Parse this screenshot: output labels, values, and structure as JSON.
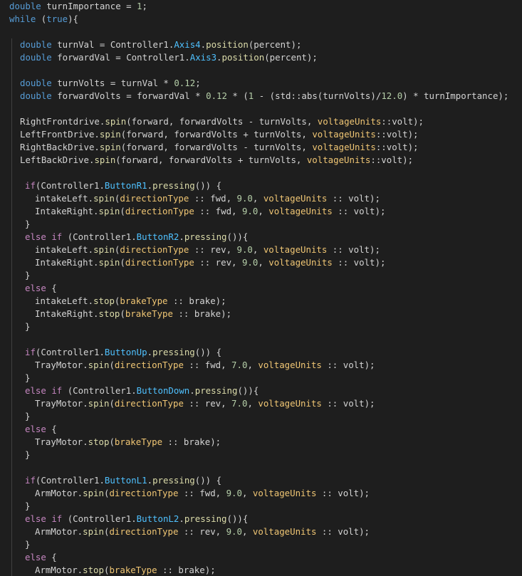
{
  "theme": {
    "background": "#1e1e1e",
    "default_text": "#d4d4d4",
    "colors": {
      "kw": "#569cd6",
      "id": "#d4d4d4",
      "fn": "#dcdcaa",
      "ty": "#4ec9b0",
      "num": "#b5cea8",
      "cf": "#c586c0",
      "mem": "#4fc1ff",
      "en": "#f0c674",
      "op": "#d4d4d4"
    }
  },
  "code_lines": [
    {
      "indent": 1,
      "tokens": [
        [
          "kw",
          "double"
        ],
        [
          "id",
          " turnImportance = "
        ],
        [
          "num",
          "1"
        ],
        [
          "id",
          ";"
        ]
      ]
    },
    {
      "indent": 1,
      "tokens": [
        [
          "kw",
          "while"
        ],
        [
          "id",
          " ("
        ],
        [
          "kw",
          "true"
        ],
        [
          "id",
          "){"
        ]
      ]
    },
    {
      "indent": 0,
      "tokens": []
    },
    {
      "indent": 3,
      "tokens": [
        [
          "kw",
          "double"
        ],
        [
          "id",
          " turnVal = Controller1."
        ],
        [
          "mem",
          "Axis4"
        ],
        [
          "id",
          "."
        ],
        [
          "fn",
          "position"
        ],
        [
          "id",
          "(percent);"
        ]
      ]
    },
    {
      "indent": 3,
      "tokens": [
        [
          "kw",
          "double"
        ],
        [
          "id",
          " forwardVal = Controller1."
        ],
        [
          "mem",
          "Axis3"
        ],
        [
          "id",
          "."
        ],
        [
          "fn",
          "position"
        ],
        [
          "id",
          "(percent);"
        ]
      ]
    },
    {
      "indent": 0,
      "tokens": []
    },
    {
      "indent": 3,
      "tokens": [
        [
          "kw",
          "double"
        ],
        [
          "id",
          " turnVolts = turnVal * "
        ],
        [
          "num",
          "0.12"
        ],
        [
          "id",
          ";"
        ]
      ]
    },
    {
      "indent": 3,
      "tokens": [
        [
          "kw",
          "double"
        ],
        [
          "id",
          " forwardVolts = forwardVal * "
        ],
        [
          "num",
          "0.12"
        ],
        [
          "id",
          " * ("
        ],
        [
          "num",
          "1"
        ],
        [
          "id",
          " - (std::abs(turnVolts)/"
        ],
        [
          "num",
          "12.0"
        ],
        [
          "id",
          ") * turnImportance);"
        ]
      ]
    },
    {
      "indent": 0,
      "tokens": []
    },
    {
      "indent": 3,
      "tokens": [
        [
          "id",
          "RightFrontdrive."
        ],
        [
          "fn",
          "spin"
        ],
        [
          "id",
          "(forward, forwardVolts - turnVolts, "
        ],
        [
          "en",
          "voltageUnits"
        ],
        [
          "id",
          "::volt);"
        ]
      ]
    },
    {
      "indent": 3,
      "tokens": [
        [
          "id",
          "LeftFrontDrive."
        ],
        [
          "fn",
          "spin"
        ],
        [
          "id",
          "(forward, forwardVolts + turnVolts, "
        ],
        [
          "en",
          "voltageUnits"
        ],
        [
          "id",
          "::volt);"
        ]
      ]
    },
    {
      "indent": 3,
      "tokens": [
        [
          "id",
          "RightBackDrive."
        ],
        [
          "fn",
          "spin"
        ],
        [
          "id",
          "(forward, forwardVolts - turnVolts, "
        ],
        [
          "en",
          "voltageUnits"
        ],
        [
          "id",
          "::volt);"
        ]
      ]
    },
    {
      "indent": 3,
      "tokens": [
        [
          "id",
          "LeftBackDrive."
        ],
        [
          "fn",
          "spin"
        ],
        [
          "id",
          "(forward, forwardVolts + turnVolts, "
        ],
        [
          "en",
          "voltageUnits"
        ],
        [
          "id",
          "::volt);"
        ]
      ]
    },
    {
      "indent": 0,
      "tokens": []
    },
    {
      "indent": 4,
      "tokens": [
        [
          "cf",
          "if"
        ],
        [
          "id",
          "(Controller1."
        ],
        [
          "mem",
          "ButtonR1"
        ],
        [
          "id",
          "."
        ],
        [
          "fn",
          "pressing"
        ],
        [
          "id",
          "()) {"
        ]
      ]
    },
    {
      "indent": 6,
      "tokens": [
        [
          "id",
          "intakeLeft."
        ],
        [
          "fn",
          "spin"
        ],
        [
          "id",
          "("
        ],
        [
          "en",
          "directionType"
        ],
        [
          "id",
          " :: fwd, "
        ],
        [
          "num",
          "9.0"
        ],
        [
          "id",
          ", "
        ],
        [
          "en",
          "voltageUnits"
        ],
        [
          "id",
          " :: volt);"
        ]
      ]
    },
    {
      "indent": 6,
      "tokens": [
        [
          "id",
          "IntakeRight."
        ],
        [
          "fn",
          "spin"
        ],
        [
          "id",
          "("
        ],
        [
          "en",
          "directionType"
        ],
        [
          "id",
          " :: fwd, "
        ],
        [
          "num",
          "9.0"
        ],
        [
          "id",
          ", "
        ],
        [
          "en",
          "voltageUnits"
        ],
        [
          "id",
          " :: volt);"
        ]
      ]
    },
    {
      "indent": 4,
      "tokens": [
        [
          "id",
          "}"
        ]
      ]
    },
    {
      "indent": 4,
      "tokens": [
        [
          "cf",
          "else"
        ],
        [
          "id",
          " "
        ],
        [
          "cf",
          "if"
        ],
        [
          "id",
          " (Controller1."
        ],
        [
          "mem",
          "ButtonR2"
        ],
        [
          "id",
          "."
        ],
        [
          "fn",
          "pressing"
        ],
        [
          "id",
          "()){"
        ]
      ]
    },
    {
      "indent": 6,
      "tokens": [
        [
          "id",
          "intakeLeft."
        ],
        [
          "fn",
          "spin"
        ],
        [
          "id",
          "("
        ],
        [
          "en",
          "directionType"
        ],
        [
          "id",
          " :: rev, "
        ],
        [
          "num",
          "9.0"
        ],
        [
          "id",
          ", "
        ],
        [
          "en",
          "voltageUnits"
        ],
        [
          "id",
          " :: volt);"
        ]
      ]
    },
    {
      "indent": 6,
      "tokens": [
        [
          "id",
          "IntakeRight."
        ],
        [
          "fn",
          "spin"
        ],
        [
          "id",
          "("
        ],
        [
          "en",
          "directionType"
        ],
        [
          "id",
          " :: rev, "
        ],
        [
          "num",
          "9.0"
        ],
        [
          "id",
          ", "
        ],
        [
          "en",
          "voltageUnits"
        ],
        [
          "id",
          " :: volt);"
        ]
      ]
    },
    {
      "indent": 4,
      "tokens": [
        [
          "id",
          "}"
        ]
      ]
    },
    {
      "indent": 4,
      "tokens": [
        [
          "cf",
          "else"
        ],
        [
          "id",
          " {"
        ]
      ]
    },
    {
      "indent": 6,
      "tokens": [
        [
          "id",
          "intakeLeft."
        ],
        [
          "fn",
          "stop"
        ],
        [
          "id",
          "("
        ],
        [
          "en",
          "brakeType"
        ],
        [
          "id",
          " :: brake);"
        ]
      ]
    },
    {
      "indent": 6,
      "tokens": [
        [
          "id",
          "IntakeRight."
        ],
        [
          "fn",
          "stop"
        ],
        [
          "id",
          "("
        ],
        [
          "en",
          "brakeType"
        ],
        [
          "id",
          " :: brake);"
        ]
      ]
    },
    {
      "indent": 4,
      "tokens": [
        [
          "id",
          "}"
        ]
      ]
    },
    {
      "indent": 0,
      "tokens": []
    },
    {
      "indent": 4,
      "tokens": [
        [
          "cf",
          "if"
        ],
        [
          "id",
          "(Controller1."
        ],
        [
          "mem",
          "ButtonUp"
        ],
        [
          "id",
          "."
        ],
        [
          "fn",
          "pressing"
        ],
        [
          "id",
          "()) {"
        ]
      ]
    },
    {
      "indent": 6,
      "tokens": [
        [
          "id",
          "TrayMotor."
        ],
        [
          "fn",
          "spin"
        ],
        [
          "id",
          "("
        ],
        [
          "en",
          "directionType"
        ],
        [
          "id",
          " :: fwd, "
        ],
        [
          "num",
          "7.0"
        ],
        [
          "id",
          ", "
        ],
        [
          "en",
          "voltageUnits"
        ],
        [
          "id",
          " :: volt);"
        ]
      ]
    },
    {
      "indent": 4,
      "tokens": [
        [
          "id",
          "}"
        ]
      ]
    },
    {
      "indent": 4,
      "tokens": [
        [
          "cf",
          "else"
        ],
        [
          "id",
          " "
        ],
        [
          "cf",
          "if"
        ],
        [
          "id",
          " (Controller1."
        ],
        [
          "mem",
          "ButtonDown"
        ],
        [
          "id",
          "."
        ],
        [
          "fn",
          "pressing"
        ],
        [
          "id",
          "()){"
        ]
      ]
    },
    {
      "indent": 6,
      "tokens": [
        [
          "id",
          "TrayMotor."
        ],
        [
          "fn",
          "spin"
        ],
        [
          "id",
          "("
        ],
        [
          "en",
          "directionType"
        ],
        [
          "id",
          " :: rev, "
        ],
        [
          "num",
          "7.0"
        ],
        [
          "id",
          ", "
        ],
        [
          "en",
          "voltageUnits"
        ],
        [
          "id",
          " :: volt);"
        ]
      ]
    },
    {
      "indent": 4,
      "tokens": [
        [
          "id",
          "}"
        ]
      ]
    },
    {
      "indent": 4,
      "tokens": [
        [
          "cf",
          "else"
        ],
        [
          "id",
          " {"
        ]
      ]
    },
    {
      "indent": 6,
      "tokens": [
        [
          "id",
          "TrayMotor."
        ],
        [
          "fn",
          "stop"
        ],
        [
          "id",
          "("
        ],
        [
          "en",
          "brakeType"
        ],
        [
          "id",
          " :: brake);"
        ]
      ]
    },
    {
      "indent": 4,
      "tokens": [
        [
          "id",
          "}"
        ]
      ]
    },
    {
      "indent": 0,
      "tokens": []
    },
    {
      "indent": 4,
      "tokens": [
        [
          "cf",
          "if"
        ],
        [
          "id",
          "(Controller1."
        ],
        [
          "mem",
          "ButtonL1"
        ],
        [
          "id",
          "."
        ],
        [
          "fn",
          "pressing"
        ],
        [
          "id",
          "()) {"
        ]
      ]
    },
    {
      "indent": 6,
      "tokens": [
        [
          "id",
          "ArmMotor."
        ],
        [
          "fn",
          "spin"
        ],
        [
          "id",
          "("
        ],
        [
          "en",
          "directionType"
        ],
        [
          "id",
          " :: fwd, "
        ],
        [
          "num",
          "9.0"
        ],
        [
          "id",
          ", "
        ],
        [
          "en",
          "voltageUnits"
        ],
        [
          "id",
          " :: volt);"
        ]
      ]
    },
    {
      "indent": 4,
      "tokens": [
        [
          "id",
          "}"
        ]
      ]
    },
    {
      "indent": 4,
      "tokens": [
        [
          "cf",
          "else"
        ],
        [
          "id",
          " "
        ],
        [
          "cf",
          "if"
        ],
        [
          "id",
          " (Controller1."
        ],
        [
          "mem",
          "ButtonL2"
        ],
        [
          "id",
          "."
        ],
        [
          "fn",
          "pressing"
        ],
        [
          "id",
          "()){"
        ]
      ]
    },
    {
      "indent": 6,
      "tokens": [
        [
          "id",
          "ArmMotor."
        ],
        [
          "fn",
          "spin"
        ],
        [
          "id",
          "("
        ],
        [
          "en",
          "directionType"
        ],
        [
          "id",
          " :: rev, "
        ],
        [
          "num",
          "9.0"
        ],
        [
          "id",
          ", "
        ],
        [
          "en",
          "voltageUnits"
        ],
        [
          "id",
          " :: volt);"
        ]
      ]
    },
    {
      "indent": 4,
      "tokens": [
        [
          "id",
          "}"
        ]
      ]
    },
    {
      "indent": 4,
      "tokens": [
        [
          "cf",
          "else"
        ],
        [
          "id",
          " {"
        ]
      ]
    },
    {
      "indent": 6,
      "tokens": [
        [
          "id",
          "ArmMotor."
        ],
        [
          "fn",
          "stop"
        ],
        [
          "id",
          "("
        ],
        [
          "en",
          "brakeType"
        ],
        [
          "id",
          " :: brake);"
        ]
      ]
    }
  ]
}
